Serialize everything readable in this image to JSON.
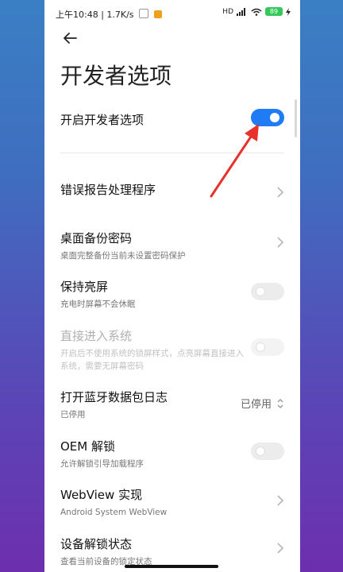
{
  "status_bar": {
    "time": "上午10:48 | 1.7K/s",
    "signal": "HD",
    "battery": "89"
  },
  "page": {
    "title": "开发者选项"
  },
  "settings": [
    {
      "label": "开启开发者选项",
      "sub": "",
      "control": "toggle",
      "state": "on"
    },
    {
      "label": "错误报告处理程序",
      "sub": "",
      "control": "chevron"
    },
    {
      "label": "桌面备份密码",
      "sub": "桌面完整备份当前未设置密码保护",
      "control": "chevron"
    },
    {
      "label": "保持亮屏",
      "sub": "充电时屏幕不会休眠",
      "control": "toggle",
      "state": "off"
    },
    {
      "label": "直接进入系统",
      "sub": "开启后不使用系统的锁屏样式，点亮屏幕直接进入系统，需要无屏幕密码",
      "control": "toggle",
      "state": "disabled"
    },
    {
      "label": "打开蓝牙数据包日志",
      "sub": "已停用",
      "control": "select",
      "value": "已停用"
    },
    {
      "label": "OEM 解锁",
      "sub": "允许解锁引导加载程序",
      "control": "toggle",
      "state": "off"
    },
    {
      "label": "WebView 实现",
      "sub": "Android System WebView",
      "control": "chevron"
    },
    {
      "label": "设备解锁状态",
      "sub": "查看当前设备的锁定状态",
      "control": "chevron"
    }
  ],
  "colors": {
    "accent": "#1f7cf5",
    "annotation": "#e8312a"
  }
}
